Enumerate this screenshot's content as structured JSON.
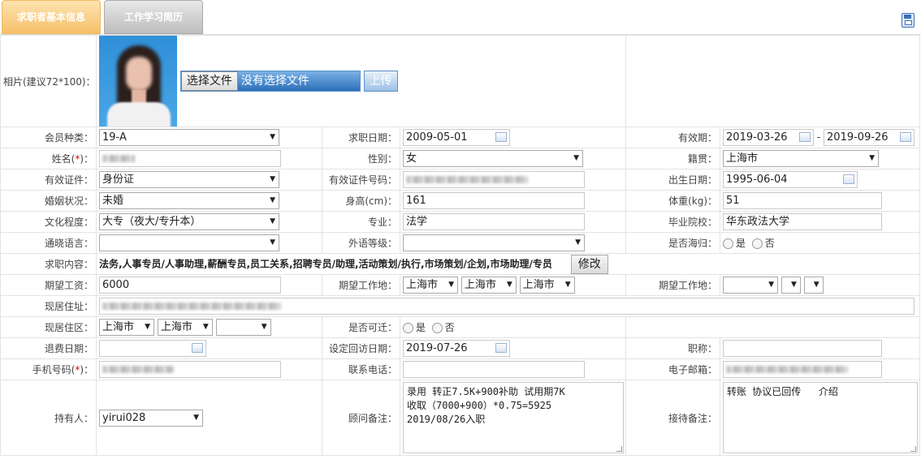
{
  "tabs": {
    "basic": "求职者基本信息",
    "history": "工作学习简历"
  },
  "labels": {
    "photo": "相片(建议72*100)：",
    "member_type": "会员种类：",
    "apply_date": "求职日期：",
    "valid_period": "有效期：",
    "name": "姓名(",
    "gender": "性别：",
    "native": "籍贯：",
    "id_type": "有效证件：",
    "id_no": "有效证件号码：",
    "birth": "出生日期：",
    "marital": "婚姻状况：",
    "height": "身高(cm)：",
    "weight": "体重(kg)：",
    "education": "文化程度：",
    "major": "专业：",
    "school": "毕业院校：",
    "language": "通晓语言：",
    "foreign_level": "外语等级：",
    "overseas": "是否海归：",
    "job_content": "求职内容：",
    "salary": "期望工资：",
    "work_place": "期望工作地：",
    "work_place2": "期望工作地：",
    "address": "现居住址：",
    "district": "现居住区：",
    "relocate": "是否可迁：",
    "refund_date": "退费日期：",
    "visit_date": "设定回访日期：",
    "title": "职称：",
    "mobile": "手机号码(",
    "phone": "联系电话：",
    "email": "电子邮箱：",
    "holder": "持有人：",
    "consultant_note": "顾问备注：",
    "reception_note": "接待备注：",
    "req_mark": "*",
    "req_close": ")：",
    "yes": "是",
    "no": "否"
  },
  "photo": {
    "choose_btn": "选择文件",
    "no_file": "没有选择文件",
    "upload_btn": "上传"
  },
  "values": {
    "member_type": "19-A",
    "apply_date": "2009-05-01",
    "valid_from": "2019-03-26",
    "valid_sep": "-",
    "valid_to": "2019-09-26",
    "gender": "女",
    "native": "上海市",
    "id_type": "身份证",
    "birth": "1995-06-04",
    "marital": "未婚",
    "height": "161",
    "weight": "51",
    "education": "大专（夜大/专升本）",
    "major": "法学",
    "school": "华东政法大学",
    "language": "",
    "foreign_level": "",
    "job_content": "法务,人事专员/人事助理,薪酬专员,员工关系,招聘专员/助理,活动策划/执行,市场策划/企划,市场助理/专员",
    "edit_btn": "修改",
    "salary": "6000",
    "work_place": [
      "上海市",
      "上海市",
      "上海市"
    ],
    "work_place2": [
      "",
      "",
      ""
    ],
    "district": [
      "上海市",
      "上海市",
      ""
    ],
    "refund_date": "",
    "visit_date": "2019-07-26",
    "title": "",
    "phone": "",
    "holder": "yirui028",
    "consultant_note": "录用 转正7.5K+900补助 试用期7K\n收取（7000+900）*0.75=5925\n2019/08/26入职",
    "reception_note": "转账 协议已回传   介绍"
  }
}
